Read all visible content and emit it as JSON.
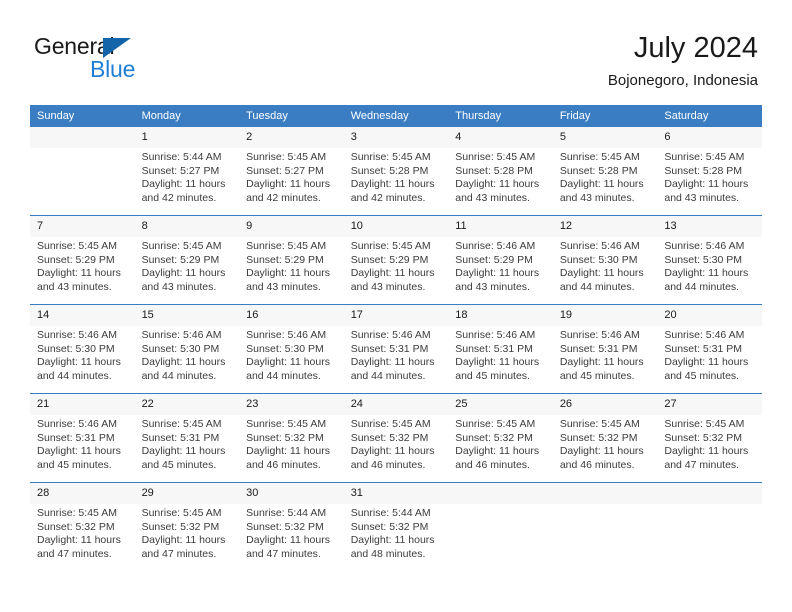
{
  "brand": {
    "name_part1": "General",
    "name_part2": "Blue",
    "triangle_color": "#1464aa",
    "blue_color": "#1f7fd4"
  },
  "header": {
    "title": "July 2024",
    "location": "Bojonegoro, Indonesia",
    "header_bg": "#3a7dc2",
    "row_line_color": "#3a7dc2",
    "daynum_bg": "#f7f7f7"
  },
  "weekday_headers": [
    "Sunday",
    "Monday",
    "Tuesday",
    "Wednesday",
    "Thursday",
    "Friday",
    "Saturday"
  ],
  "labels": {
    "sunrise": "Sunrise:",
    "sunset": "Sunset:",
    "daylight": "Daylight:"
  },
  "weeks": [
    [
      {
        "day": "",
        "sunrise": "",
        "sunset": "",
        "daylight_line1": "",
        "daylight_line2": "",
        "empty": true
      },
      {
        "day": "1",
        "sunrise": "Sunrise: 5:44 AM",
        "sunset": "Sunset: 5:27 PM",
        "daylight_line1": "Daylight: 11 hours",
        "daylight_line2": "and 42 minutes."
      },
      {
        "day": "2",
        "sunrise": "Sunrise: 5:45 AM",
        "sunset": "Sunset: 5:27 PM",
        "daylight_line1": "Daylight: 11 hours",
        "daylight_line2": "and 42 minutes."
      },
      {
        "day": "3",
        "sunrise": "Sunrise: 5:45 AM",
        "sunset": "Sunset: 5:28 PM",
        "daylight_line1": "Daylight: 11 hours",
        "daylight_line2": "and 42 minutes."
      },
      {
        "day": "4",
        "sunrise": "Sunrise: 5:45 AM",
        "sunset": "Sunset: 5:28 PM",
        "daylight_line1": "Daylight: 11 hours",
        "daylight_line2": "and 43 minutes."
      },
      {
        "day": "5",
        "sunrise": "Sunrise: 5:45 AM",
        "sunset": "Sunset: 5:28 PM",
        "daylight_line1": "Daylight: 11 hours",
        "daylight_line2": "and 43 minutes."
      },
      {
        "day": "6",
        "sunrise": "Sunrise: 5:45 AM",
        "sunset": "Sunset: 5:28 PM",
        "daylight_line1": "Daylight: 11 hours",
        "daylight_line2": "and 43 minutes."
      }
    ],
    [
      {
        "day": "7",
        "sunrise": "Sunrise: 5:45 AM",
        "sunset": "Sunset: 5:29 PM",
        "daylight_line1": "Daylight: 11 hours",
        "daylight_line2": "and 43 minutes."
      },
      {
        "day": "8",
        "sunrise": "Sunrise: 5:45 AM",
        "sunset": "Sunset: 5:29 PM",
        "daylight_line1": "Daylight: 11 hours",
        "daylight_line2": "and 43 minutes."
      },
      {
        "day": "9",
        "sunrise": "Sunrise: 5:45 AM",
        "sunset": "Sunset: 5:29 PM",
        "daylight_line1": "Daylight: 11 hours",
        "daylight_line2": "and 43 minutes."
      },
      {
        "day": "10",
        "sunrise": "Sunrise: 5:45 AM",
        "sunset": "Sunset: 5:29 PM",
        "daylight_line1": "Daylight: 11 hours",
        "daylight_line2": "and 43 minutes."
      },
      {
        "day": "11",
        "sunrise": "Sunrise: 5:46 AM",
        "sunset": "Sunset: 5:29 PM",
        "daylight_line1": "Daylight: 11 hours",
        "daylight_line2": "and 43 minutes."
      },
      {
        "day": "12",
        "sunrise": "Sunrise: 5:46 AM",
        "sunset": "Sunset: 5:30 PM",
        "daylight_line1": "Daylight: 11 hours",
        "daylight_line2": "and 44 minutes."
      },
      {
        "day": "13",
        "sunrise": "Sunrise: 5:46 AM",
        "sunset": "Sunset: 5:30 PM",
        "daylight_line1": "Daylight: 11 hours",
        "daylight_line2": "and 44 minutes."
      }
    ],
    [
      {
        "day": "14",
        "sunrise": "Sunrise: 5:46 AM",
        "sunset": "Sunset: 5:30 PM",
        "daylight_line1": "Daylight: 11 hours",
        "daylight_line2": "and 44 minutes."
      },
      {
        "day": "15",
        "sunrise": "Sunrise: 5:46 AM",
        "sunset": "Sunset: 5:30 PM",
        "daylight_line1": "Daylight: 11 hours",
        "daylight_line2": "and 44 minutes."
      },
      {
        "day": "16",
        "sunrise": "Sunrise: 5:46 AM",
        "sunset": "Sunset: 5:30 PM",
        "daylight_line1": "Daylight: 11 hours",
        "daylight_line2": "and 44 minutes."
      },
      {
        "day": "17",
        "sunrise": "Sunrise: 5:46 AM",
        "sunset": "Sunset: 5:31 PM",
        "daylight_line1": "Daylight: 11 hours",
        "daylight_line2": "and 44 minutes."
      },
      {
        "day": "18",
        "sunrise": "Sunrise: 5:46 AM",
        "sunset": "Sunset: 5:31 PM",
        "daylight_line1": "Daylight: 11 hours",
        "daylight_line2": "and 45 minutes."
      },
      {
        "day": "19",
        "sunrise": "Sunrise: 5:46 AM",
        "sunset": "Sunset: 5:31 PM",
        "daylight_line1": "Daylight: 11 hours",
        "daylight_line2": "and 45 minutes."
      },
      {
        "day": "20",
        "sunrise": "Sunrise: 5:46 AM",
        "sunset": "Sunset: 5:31 PM",
        "daylight_line1": "Daylight: 11 hours",
        "daylight_line2": "and 45 minutes."
      }
    ],
    [
      {
        "day": "21",
        "sunrise": "Sunrise: 5:46 AM",
        "sunset": "Sunset: 5:31 PM",
        "daylight_line1": "Daylight: 11 hours",
        "daylight_line2": "and 45 minutes."
      },
      {
        "day": "22",
        "sunrise": "Sunrise: 5:45 AM",
        "sunset": "Sunset: 5:31 PM",
        "daylight_line1": "Daylight: 11 hours",
        "daylight_line2": "and 45 minutes."
      },
      {
        "day": "23",
        "sunrise": "Sunrise: 5:45 AM",
        "sunset": "Sunset: 5:32 PM",
        "daylight_line1": "Daylight: 11 hours",
        "daylight_line2": "and 46 minutes."
      },
      {
        "day": "24",
        "sunrise": "Sunrise: 5:45 AM",
        "sunset": "Sunset: 5:32 PM",
        "daylight_line1": "Daylight: 11 hours",
        "daylight_line2": "and 46 minutes."
      },
      {
        "day": "25",
        "sunrise": "Sunrise: 5:45 AM",
        "sunset": "Sunset: 5:32 PM",
        "daylight_line1": "Daylight: 11 hours",
        "daylight_line2": "and 46 minutes."
      },
      {
        "day": "26",
        "sunrise": "Sunrise: 5:45 AM",
        "sunset": "Sunset: 5:32 PM",
        "daylight_line1": "Daylight: 11 hours",
        "daylight_line2": "and 46 minutes."
      },
      {
        "day": "27",
        "sunrise": "Sunrise: 5:45 AM",
        "sunset": "Sunset: 5:32 PM",
        "daylight_line1": "Daylight: 11 hours",
        "daylight_line2": "and 47 minutes."
      }
    ],
    [
      {
        "day": "28",
        "sunrise": "Sunrise: 5:45 AM",
        "sunset": "Sunset: 5:32 PM",
        "daylight_line1": "Daylight: 11 hours",
        "daylight_line2": "and 47 minutes."
      },
      {
        "day": "29",
        "sunrise": "Sunrise: 5:45 AM",
        "sunset": "Sunset: 5:32 PM",
        "daylight_line1": "Daylight: 11 hours",
        "daylight_line2": "and 47 minutes."
      },
      {
        "day": "30",
        "sunrise": "Sunrise: 5:44 AM",
        "sunset": "Sunset: 5:32 PM",
        "daylight_line1": "Daylight: 11 hours",
        "daylight_line2": "and 47 minutes."
      },
      {
        "day": "31",
        "sunrise": "Sunrise: 5:44 AM",
        "sunset": "Sunset: 5:32 PM",
        "daylight_line1": "Daylight: 11 hours",
        "daylight_line2": "and 48 minutes."
      },
      {
        "day": "",
        "sunrise": "",
        "sunset": "",
        "daylight_line1": "",
        "daylight_line2": "",
        "empty": true
      },
      {
        "day": "",
        "sunrise": "",
        "sunset": "",
        "daylight_line1": "",
        "daylight_line2": "",
        "empty": true
      },
      {
        "day": "",
        "sunrise": "",
        "sunset": "",
        "daylight_line1": "",
        "daylight_line2": "",
        "empty": true
      }
    ]
  ]
}
